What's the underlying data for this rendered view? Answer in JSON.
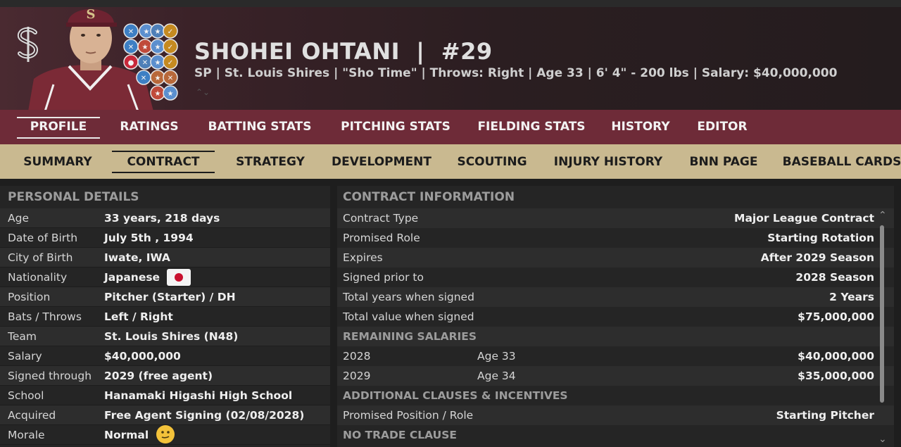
{
  "header": {
    "player_name": "SHOHEI OHTANI",
    "separator": "|",
    "number": "#29",
    "subtitle": "SP | St. Louis Shires  |  \"Sho Time\" | Throws: Right  |  Age 33  |  6' 4\"  - 200 lbs  |  Salary: $40,000,000",
    "chevron": "⌃⌄"
  },
  "main_tabs": [
    "PROFILE",
    "RATINGS",
    "BATTING STATS",
    "PITCHING STATS",
    "FIELDING STATS",
    "HISTORY",
    "EDITOR"
  ],
  "main_tab_active": "PROFILE",
  "sub_tabs": [
    "SUMMARY",
    "CONTRACT",
    "STRATEGY",
    "DEVELOPMENT",
    "SCOUTING",
    "INJURY HISTORY",
    "BNN PAGE",
    "BASEBALL CARDS"
  ],
  "sub_tab_active": "CONTRACT",
  "personal": {
    "title": "PERSONAL DETAILS",
    "rows": [
      {
        "label": "Age",
        "value": "33 years, 218 days"
      },
      {
        "label": "Date of Birth",
        "value": "July 5th , 1994"
      },
      {
        "label": "City of Birth",
        "value": "Iwate, IWA"
      },
      {
        "label": "Nationality",
        "value": "Japanese"
      },
      {
        "label": "Position",
        "value": "Pitcher (Starter) / DH"
      },
      {
        "label": "Bats / Throws",
        "value": "Left / Right"
      },
      {
        "label": "Team",
        "value": "St. Louis Shires (N48)"
      },
      {
        "label": "Salary",
        "value": "$40,000,000"
      },
      {
        "label": "Signed through",
        "value": "2029 (free agent)"
      },
      {
        "label": "School",
        "value": "Hanamaki Higashi High School"
      },
      {
        "label": "Acquired",
        "value": "Free Agent Signing (02/08/2028)"
      },
      {
        "label": "Morale",
        "value": "Normal"
      }
    ]
  },
  "contract": {
    "title": "CONTRACT INFORMATION",
    "rows": [
      {
        "label": "Contract Type",
        "value": "Major League Contract"
      },
      {
        "label": "Promised Role",
        "value": "Starting Rotation"
      },
      {
        "label": "Expires",
        "value": "After 2029 Season"
      },
      {
        "label": "Signed prior to",
        "value": "2028 Season"
      },
      {
        "label": "Total years when signed",
        "value": "2 Years"
      },
      {
        "label": "Total value when signed",
        "value": "$75,000,000"
      }
    ],
    "remaining_heading": "REMAINING SALARIES",
    "remaining": [
      {
        "year": "2028",
        "age": "Age 33",
        "value": "$40,000,000"
      },
      {
        "year": "2029",
        "age": "Age 34",
        "value": "$35,000,000"
      }
    ],
    "clauses_heading": "ADDITIONAL CLAUSES & INCENTIVES",
    "clauses": [
      {
        "label": "Promised Position / Role",
        "value": "Starting Pitcher"
      }
    ],
    "no_trade": "NO TRADE CLAUSE"
  },
  "colors": {
    "maintab_bg": "#6e2b38",
    "subtab_bg": "#c9b990",
    "panel_bg": "#252525",
    "header_bg": "#3a2228"
  },
  "icons": {
    "team_logo": "shires-s-logo-icon",
    "flag": "japan-flag-icon",
    "morale": "smiley-face-icon"
  }
}
